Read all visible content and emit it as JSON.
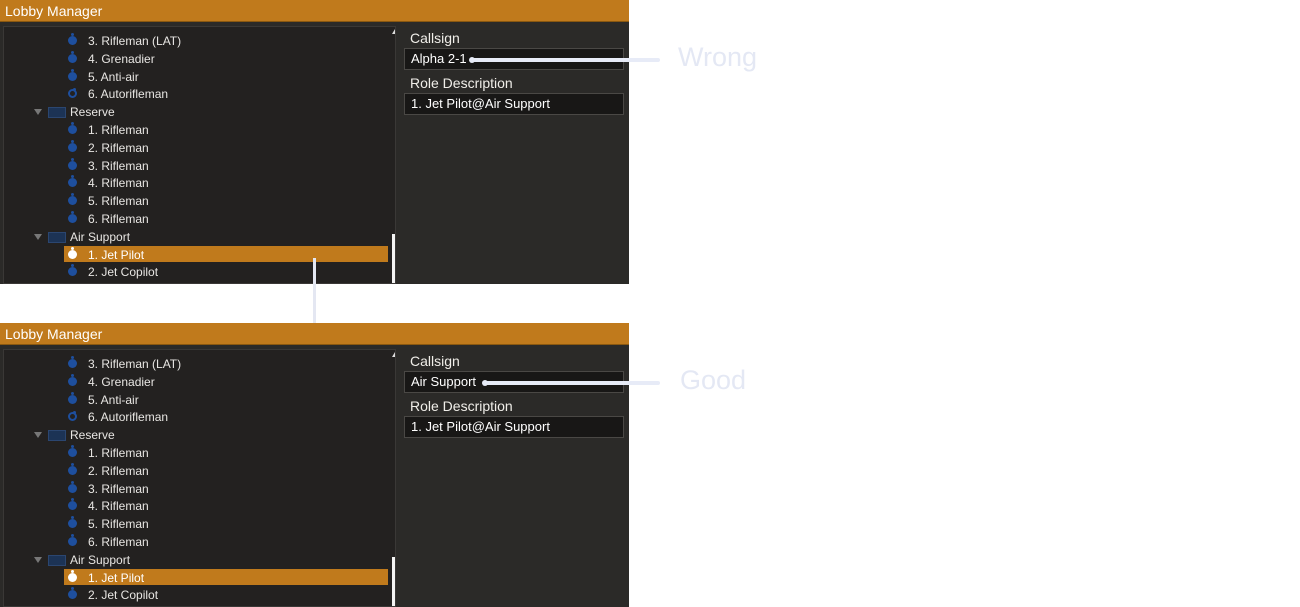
{
  "title": "Lobby Manager",
  "callsign_label": "Callsign",
  "role_description_label": "Role Description",
  "panels": [
    {
      "callsign_value": "Alpha 2-1",
      "role_description_value": "1. Jet Pilot@Air Support",
      "annotation": "Wrong"
    },
    {
      "callsign_value": "Air Support",
      "role_description_value": "1. Jet Pilot@Air Support",
      "annotation": "Good"
    }
  ],
  "tree": [
    {
      "type": "role",
      "label": "3. Rifleman (LAT)"
    },
    {
      "type": "role",
      "label": "4. Grenadier"
    },
    {
      "type": "role",
      "label": "5. Anti-air"
    },
    {
      "type": "role",
      "label": "6. Autorifleman",
      "icon": "hollow"
    },
    {
      "type": "group",
      "label": "Reserve"
    },
    {
      "type": "role",
      "label": "1. Rifleman"
    },
    {
      "type": "role",
      "label": "2. Rifleman"
    },
    {
      "type": "role",
      "label": "3. Rifleman"
    },
    {
      "type": "role",
      "label": "4. Rifleman"
    },
    {
      "type": "role",
      "label": "5. Rifleman"
    },
    {
      "type": "role",
      "label": "6. Rifleman"
    },
    {
      "type": "group",
      "label": "Air Support"
    },
    {
      "type": "role",
      "label": "1. Jet Pilot",
      "selected": true
    },
    {
      "type": "role",
      "label": "2. Jet Copilot"
    }
  ],
  "colors": {
    "accent": "#c07a1c",
    "role_icon": "#1e4f9e",
    "annotation": "#e7ebf7"
  }
}
